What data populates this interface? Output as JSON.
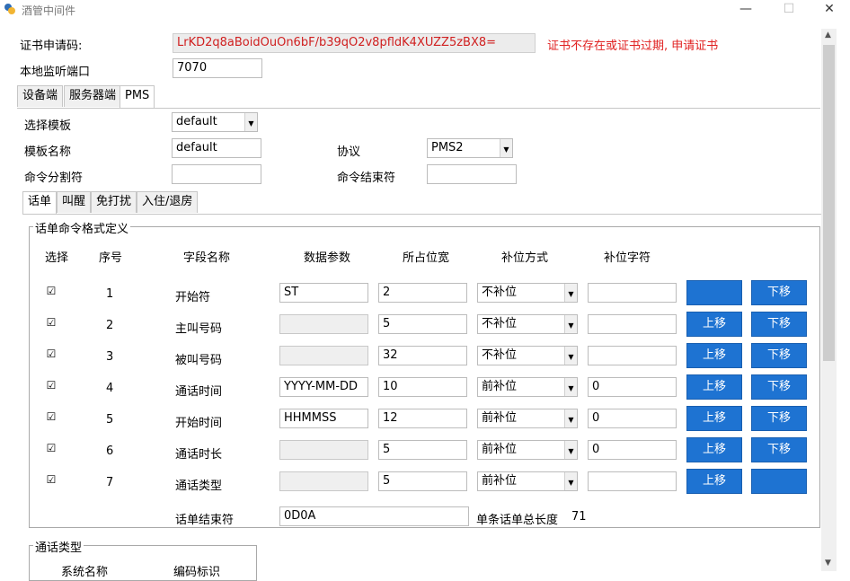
{
  "window": {
    "title": "酒管中间件",
    "minimize": "—",
    "maximize": "☐",
    "close": "✕"
  },
  "cert": {
    "label": "证书申请码:",
    "value": "LrKD2q8aBoidOuOn6bF/b39qO2v8pfldK4XUZZ5zBX8=",
    "error": "证书不存在或证书过期, 申请证书",
    "error_color": "#e02020"
  },
  "port": {
    "label": "本地监听端口",
    "value": "7070"
  },
  "main_tabs": [
    {
      "label": "设备端"
    },
    {
      "label": "服务器端"
    },
    {
      "label": "PMS"
    }
  ],
  "pms": {
    "template_select_label": "选择模板",
    "template_select_value": "default",
    "template_name_label": "模板名称",
    "template_name_value": "default",
    "protocol_label": "协议",
    "protocol_value": "PMS2",
    "cmd_sep_label": "命令分割符",
    "cmd_sep_value": "",
    "cmd_end_label": "命令结束符",
    "cmd_end_value": ""
  },
  "sub_tabs": [
    {
      "label": "话单"
    },
    {
      "label": "叫醒"
    },
    {
      "label": "免打扰"
    },
    {
      "label": "入住/退房"
    }
  ],
  "record_group": {
    "title": "话单命令格式定义",
    "headers": [
      "选择",
      "序号",
      "字段名称",
      "数据参数",
      "所占位宽",
      "补位方式",
      "补位字符"
    ],
    "rows": [
      {
        "checked": "☑",
        "no": "1",
        "name": "开始符",
        "param": "ST",
        "param_gray": false,
        "width": "2",
        "pad_mode": "不补位",
        "pad_char": "",
        "up": "",
        "down": "下移"
      },
      {
        "checked": "☑",
        "no": "2",
        "name": "主叫号码",
        "param": "",
        "param_gray": true,
        "width": "5",
        "pad_mode": "不补位",
        "pad_char": "",
        "up": "上移",
        "down": "下移"
      },
      {
        "checked": "☑",
        "no": "3",
        "name": "被叫号码",
        "param": "",
        "param_gray": true,
        "width": "32",
        "pad_mode": "不补位",
        "pad_char": "",
        "up": "上移",
        "down": "下移"
      },
      {
        "checked": "☑",
        "no": "4",
        "name": "通话时间",
        "param": "YYYY-MM-DD",
        "param_gray": false,
        "width": "10",
        "pad_mode": "前补位",
        "pad_char": "0",
        "up": "上移",
        "down": "下移"
      },
      {
        "checked": "☑",
        "no": "5",
        "name": "开始时间",
        "param": "HHMMSS",
        "param_gray": false,
        "width": "12",
        "pad_mode": "前补位",
        "pad_char": "0",
        "up": "上移",
        "down": "下移"
      },
      {
        "checked": "☑",
        "no": "6",
        "name": "通话时长",
        "param": "",
        "param_gray": true,
        "width": "5",
        "pad_mode": "前补位",
        "pad_char": "0",
        "up": "上移",
        "down": "下移"
      },
      {
        "checked": "☑",
        "no": "7",
        "name": "通话类型",
        "param": "",
        "param_gray": true,
        "width": "5",
        "pad_mode": "前补位",
        "pad_char": "",
        "up": "上移",
        "down": ""
      }
    ],
    "end_label": "话单结束符",
    "end_value": "0D0A",
    "total_label": "单条话单总长度",
    "total_value": "71"
  },
  "call_type_group": {
    "title": "通话类型",
    "col1": "系统名称",
    "col2": "编码标识"
  },
  "colors": {
    "accent": "#1e73d2"
  }
}
